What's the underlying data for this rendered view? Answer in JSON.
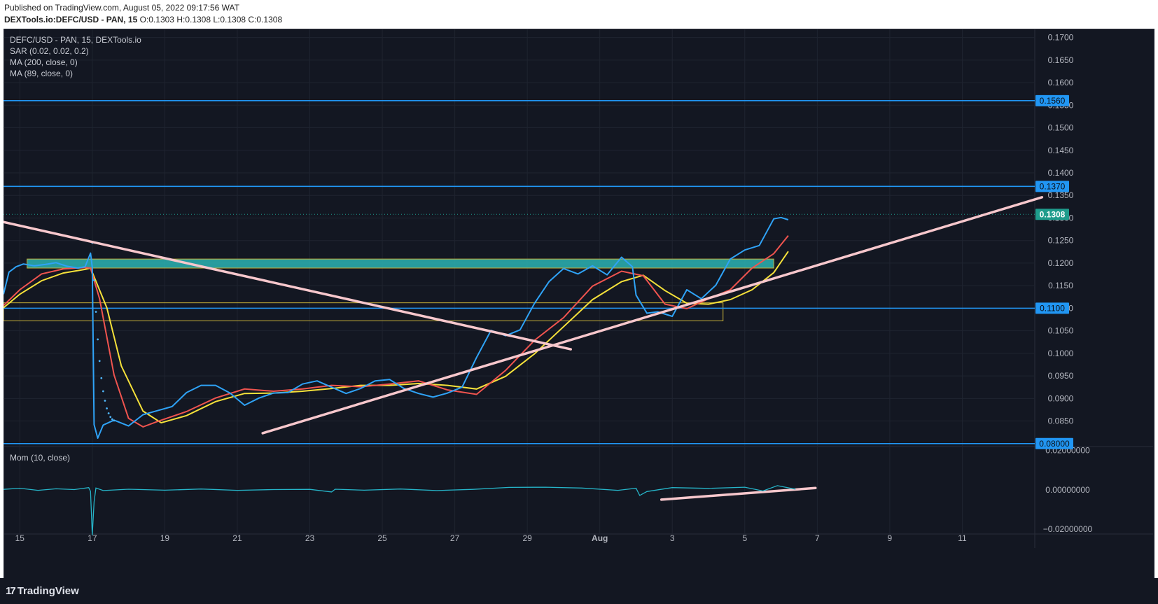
{
  "header": {
    "published": "Published on TradingView.com, August 05, 2022 09:17:56 WAT",
    "symbol": "DEXTools.io:DEFC/USD - PAN, 15",
    "ohlc": {
      "o": "O:0.1303",
      "h": "H:0.1308",
      "l": "L:0.1308",
      "c": "C:0.1308"
    }
  },
  "legend": {
    "title": "DEFC/USD - PAN, 15, DEXTools.io",
    "sar": "SAR (0.02, 0.02, 0.2)",
    "ma200": "MA (200, close, 0)",
    "ma89": "MA (89, close, 0)",
    "mom": "Mom (10, close)"
  },
  "footer": {
    "brand": "TradingView"
  },
  "colors": {
    "background": "#131722",
    "grid": "#1f2430",
    "price": "#2fa3f7",
    "sar": "#4fb3f5",
    "ma_fast": "#f0544f",
    "ma_slow": "#f5e13a",
    "trendline": "#f7c7cc",
    "zone_fill": "#2bb3b3",
    "zone_border": "#c8b23a",
    "level": "#2196f3",
    "last_price": "#1e9c8c",
    "momentum": "#26b5c9"
  },
  "chart_data": {
    "type": "line",
    "title": "DEFC/USD - PAN, 15, DEXTools.io",
    "x_ticks": [
      "15",
      "17",
      "19",
      "21",
      "23",
      "25",
      "27",
      "29",
      "Aug",
      "3",
      "5",
      "7",
      "9",
      "11"
    ],
    "y_ticks": [
      "0.1700",
      "0.1650",
      "0.1600",
      "0.1550",
      "0.1500",
      "0.1450",
      "0.1400",
      "0.1350",
      "0.1300",
      "0.1250",
      "0.1200",
      "0.1150",
      "0.1100",
      "0.1050",
      "0.1000",
      "0.0950",
      "0.0900",
      "0.0850",
      "0.0800"
    ],
    "ylim": [
      0.0795,
      0.1718
    ],
    "x_range": [
      14.55,
      43.0
    ],
    "price_labels": [
      {
        "text": "0.1560",
        "value": 0.156,
        "kind": "level"
      },
      {
        "text": "0.1370",
        "value": 0.137,
        "kind": "level"
      },
      {
        "text": "0.1308",
        "value": 0.1308,
        "kind": "last"
      },
      {
        "text": "0.1100",
        "value": 0.11,
        "kind": "level"
      },
      {
        "text": "0.08000",
        "value": 0.08,
        "kind": "level"
      }
    ],
    "horizontal_levels": [
      0.156,
      0.137,
      0.11,
      0.08
    ],
    "zones": [
      {
        "x": [
          15.2,
          35.8
        ],
        "y": [
          0.1189,
          0.1209
        ],
        "style": "filled"
      },
      {
        "x": [
          14.55,
          34.4
        ],
        "y": [
          0.1072,
          0.1112
        ],
        "style": "outline"
      }
    ],
    "trendlines": [
      {
        "from": [
          14.55,
          0.1291
        ],
        "to": [
          30.2,
          0.1009
        ]
      },
      {
        "from": [
          21.7,
          0.0823
        ],
        "to": [
          43.2,
          0.1346
        ]
      },
      {
        "pane": "momentum",
        "from": [
          32.7,
          -0.005
        ],
        "to": [
          36.95,
          0.0009
        ]
      }
    ],
    "series": [
      {
        "name": "Price",
        "x": [
          14.55,
          14.7,
          14.9,
          15.1,
          15.4,
          15.7,
          16.0,
          16.3,
          16.6,
          16.8,
          16.95,
          17.0,
          17.05,
          17.15,
          17.3,
          17.6,
          18.0,
          18.4,
          18.8,
          19.2,
          19.6,
          20.0,
          20.4,
          20.8,
          21.2,
          21.6,
          22.0,
          22.4,
          22.8,
          23.2,
          23.6,
          24.0,
          24.4,
          24.8,
          25.2,
          25.6,
          26.0,
          26.4,
          26.8,
          27.2,
          27.6,
          28.0,
          28.4,
          28.8,
          29.2,
          29.6,
          30.0,
          30.4,
          30.8,
          31.2,
          31.6,
          31.9,
          32.0,
          32.3,
          32.6,
          33.0,
          33.4,
          33.8,
          34.2,
          34.6,
          35.0,
          35.4,
          35.8,
          36.0,
          36.2
        ],
        "values": [
          0.1131,
          0.118,
          0.1192,
          0.1198,
          0.1194,
          0.1197,
          0.1201,
          0.1193,
          0.1189,
          0.1192,
          0.1222,
          0.1191,
          0.0842,
          0.0812,
          0.0841,
          0.0852,
          0.0839,
          0.0864,
          0.0873,
          0.0882,
          0.0913,
          0.0929,
          0.0929,
          0.0912,
          0.0885,
          0.0901,
          0.0912,
          0.0913,
          0.0932,
          0.0939,
          0.0925,
          0.0911,
          0.0922,
          0.0939,
          0.0942,
          0.0922,
          0.0911,
          0.0903,
          0.0912,
          0.0925,
          0.0991,
          0.1051,
          0.1039,
          0.1052,
          0.1111,
          0.1159,
          0.1188,
          0.1176,
          0.1194,
          0.1174,
          0.1213,
          0.1192,
          0.1129,
          0.1089,
          0.1092,
          0.1082,
          0.1141,
          0.1121,
          0.1151,
          0.1209,
          0.1229,
          0.1239,
          0.1298,
          0.1301,
          0.1296
        ]
      },
      {
        "name": "MA (89, close, 0)",
        "x": [
          14.55,
          15.0,
          15.6,
          16.2,
          16.8,
          16.95,
          17.2,
          17.6,
          18.0,
          18.4,
          18.8,
          19.6,
          20.4,
          21.2,
          22.0,
          22.8,
          23.6,
          24.4,
          25.2,
          26.0,
          26.8,
          27.6,
          28.4,
          29.2,
          30.0,
          30.8,
          31.6,
          32.2,
          32.8,
          33.4,
          34.0,
          34.6,
          35.2,
          35.8,
          36.2
        ],
        "values": [
          0.1106,
          0.1141,
          0.1176,
          0.1187,
          0.119,
          0.1189,
          0.1121,
          0.0952,
          0.0856,
          0.0837,
          0.0849,
          0.0871,
          0.0901,
          0.0921,
          0.0916,
          0.0921,
          0.0929,
          0.0926,
          0.0932,
          0.0939,
          0.0919,
          0.0909,
          0.0962,
          0.1029,
          0.1079,
          0.1149,
          0.1182,
          0.1172,
          0.1109,
          0.1099,
          0.1121,
          0.1141,
          0.1189,
          0.1221,
          0.1261
        ]
      },
      {
        "name": "MA (200, close, 0)",
        "x": [
          14.55,
          15.0,
          15.6,
          16.2,
          16.8,
          16.95,
          17.4,
          17.8,
          18.4,
          18.9,
          19.6,
          20.4,
          21.2,
          22.0,
          22.8,
          23.6,
          24.4,
          25.2,
          26.0,
          26.8,
          27.6,
          28.4,
          29.2,
          30.0,
          30.8,
          31.6,
          32.2,
          32.8,
          33.4,
          34.0,
          34.6,
          35.2,
          35.8,
          36.2
        ],
        "values": [
          0.1101,
          0.1131,
          0.1161,
          0.1178,
          0.1186,
          0.1189,
          0.1101,
          0.0972,
          0.0872,
          0.0846,
          0.0862,
          0.0893,
          0.0911,
          0.0912,
          0.0916,
          0.0922,
          0.0929,
          0.0929,
          0.0933,
          0.0929,
          0.0921,
          0.0949,
          0.0999,
          0.1059,
          0.1119,
          0.1159,
          0.1173,
          0.1139,
          0.1111,
          0.1109,
          0.1119,
          0.1141,
          0.1179,
          0.1226
        ]
      },
      {
        "name": "SAR (0.02, 0.02, 0.2)",
        "x": [
          17.0,
          17.05,
          17.1,
          17.15,
          17.2,
          17.25,
          17.3,
          17.35,
          17.4,
          17.45,
          17.5,
          17.55,
          17.6
        ],
        "values": [
          0.1245,
          0.1162,
          0.1092,
          0.1031,
          0.0983,
          0.0945,
          0.0916,
          0.0895,
          0.0878,
          0.0867,
          0.0859,
          0.0854,
          0.0851
        ]
      },
      {
        "name": "Mom (10, close)",
        "x": [
          14.55,
          15.0,
          15.5,
          16.0,
          16.5,
          16.9,
          16.95,
          17.0,
          17.05,
          17.1,
          17.3,
          18.0,
          19.0,
          20.0,
          21.0,
          22.0,
          23.0,
          23.6,
          23.7,
          24.5,
          25.5,
          26.5,
          27.5,
          28.5,
          29.5,
          30.5,
          31.5,
          32.0,
          32.1,
          32.3,
          33.0,
          34.0,
          35.0,
          35.5,
          35.9,
          36.4
        ],
        "values": [
          0.0002,
          0.0008,
          -0.0003,
          0.0005,
          0.0001,
          0.0011,
          -0.0008,
          -0.0231,
          -0.0061,
          0.0009,
          -0.0004,
          0.0003,
          -0.0002,
          0.0004,
          -0.0003,
          0.0001,
          0.0002,
          -0.0011,
          0.0003,
          -0.0002,
          0.0004,
          -0.0004,
          0.0002,
          0.0012,
          0.0013,
          0.0009,
          -0.0003,
          0.0008,
          -0.0029,
          -0.0009,
          0.0011,
          0.0007,
          0.0013,
          -0.0006,
          0.0021,
          0.0003
        ]
      }
    ],
    "momentum_ylim": [
      -0.0225,
      0.022
    ],
    "momentum_ticks": [
      "0.02000000",
      "0.00000000",
      "−0.02000000"
    ],
    "grid": true,
    "legend": "top-left"
  }
}
